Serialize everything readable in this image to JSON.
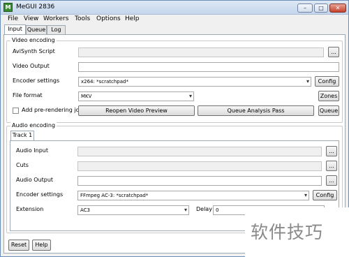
{
  "window": {
    "title": "MeGUI 2836"
  },
  "menu": [
    "File",
    "View",
    "Workers",
    "Tools",
    "Options",
    "Help"
  ],
  "tabs": [
    "Input",
    "Queue",
    "Log"
  ],
  "video": {
    "group_title": "Video encoding",
    "avisynth_label": "AviSynth Script",
    "output_label": "Video Output",
    "encoder_label": "Encoder settings",
    "encoder_value": "x264: *scratchpad*",
    "format_label": "File format",
    "format_value": "MKV",
    "prerender_label": "Add pre-rendering job",
    "reopen_label": "Reopen Video Preview",
    "queue_analysis_label": "Queue Analysis Pass",
    "config_label": "Config",
    "zones_label": "Zones",
    "queue_label": "Queue",
    "browse_label": "..."
  },
  "audio": {
    "group_title": "Audio encoding",
    "track_tab": "Track 1",
    "input_label": "Audio Input",
    "cuts_label": "Cuts",
    "output_label": "Audio Output",
    "encoder_label": "Encoder settings",
    "encoder_value": "FFmpeg AC-3: *scratchpad*",
    "extension_label": "Extension",
    "extension_value": "AC3",
    "delay_label": "Delay",
    "delay_value": "0",
    "config_label": "Config",
    "browse_label": "..."
  },
  "footer": {
    "reset_label": "Reset",
    "help_label": "Help"
  },
  "watermark": {
    "text": "软件技巧"
  }
}
